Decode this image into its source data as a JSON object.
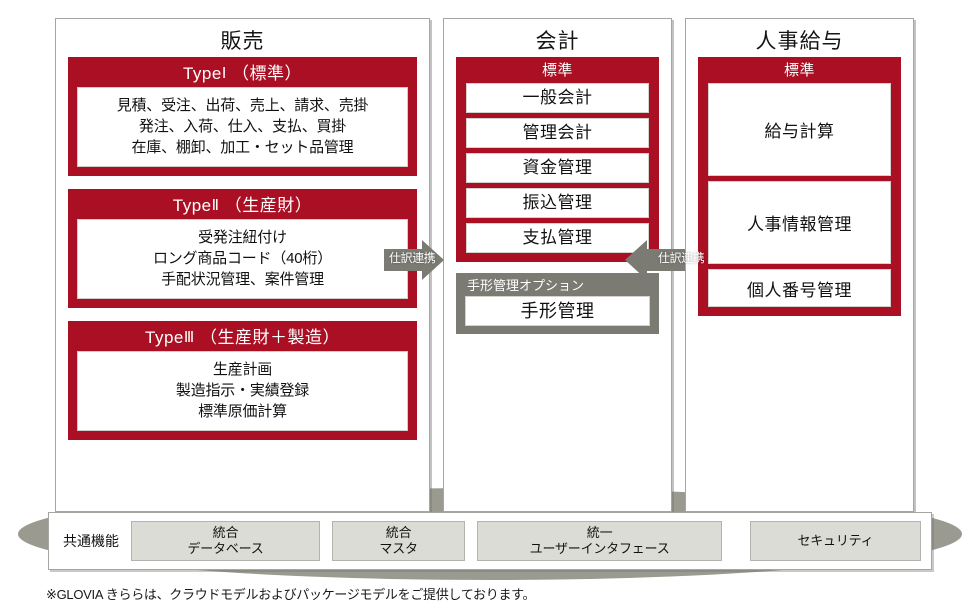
{
  "columns": [
    {
      "id": "sales",
      "title": "販売",
      "blocks": [
        {
          "title_prefix": "Type",
          "roman": "Ⅰ",
          "title_suffix": "（標準）",
          "lines": [
            "見積、受注、出荷、売上、請求、売掛",
            "発注、入荷、仕入、支払、買掛",
            "在庫、棚卸、加工・セット品管理"
          ]
        },
        {
          "title_prefix": "Type",
          "roman": "Ⅱ",
          "title_suffix": "（生産財）",
          "lines": [
            "受発注紐付け",
            "ロング商品コード（40桁）",
            "手配状況管理、案件管理"
          ]
        },
        {
          "title_prefix": "Type",
          "roman": "Ⅲ",
          "title_suffix": "（生産財＋製造）",
          "lines": [
            "生産計画",
            "製造指示・実績登録",
            "標準原価計算"
          ]
        }
      ]
    },
    {
      "id": "accounting",
      "title": "会計",
      "standard_label": "標準",
      "items": [
        "一般会計",
        "管理会計",
        "資金管理",
        "振込管理",
        "支払管理"
      ],
      "option": {
        "title": "手形管理オプション",
        "items": [
          "手形管理"
        ]
      }
    },
    {
      "id": "hr",
      "title": "人事給与",
      "standard_label": "標準",
      "items": [
        "給与計算",
        "人事情報管理",
        "個人番号管理"
      ]
    }
  ],
  "arrows": {
    "left": {
      "label": "仕訳連携",
      "direction": "right"
    },
    "right": {
      "label": "仕訳連携",
      "direction": "left"
    }
  },
  "common": {
    "label": "共通機能",
    "chips": [
      {
        "id": "db",
        "line1": "統合",
        "line2": "データベース"
      },
      {
        "id": "master",
        "line1": "統合",
        "line2": "マスタ"
      },
      {
        "id": "ui",
        "line1": "統一",
        "line2": "ユーザーインタフェース"
      },
      {
        "id": "security",
        "line1": "セキュリティ",
        "line2": ""
      }
    ]
  },
  "footnote": "※GLOVIA きららは、クラウドモデルおよびパッケージモデルをご提供しております。",
  "colors": {
    "brand_red": "#aa0f23",
    "gray_block": "#7b7b73",
    "chip_fill": "#dcdcd6",
    "ellipse": "#9a9a91",
    "border": "#a6a6a0"
  }
}
